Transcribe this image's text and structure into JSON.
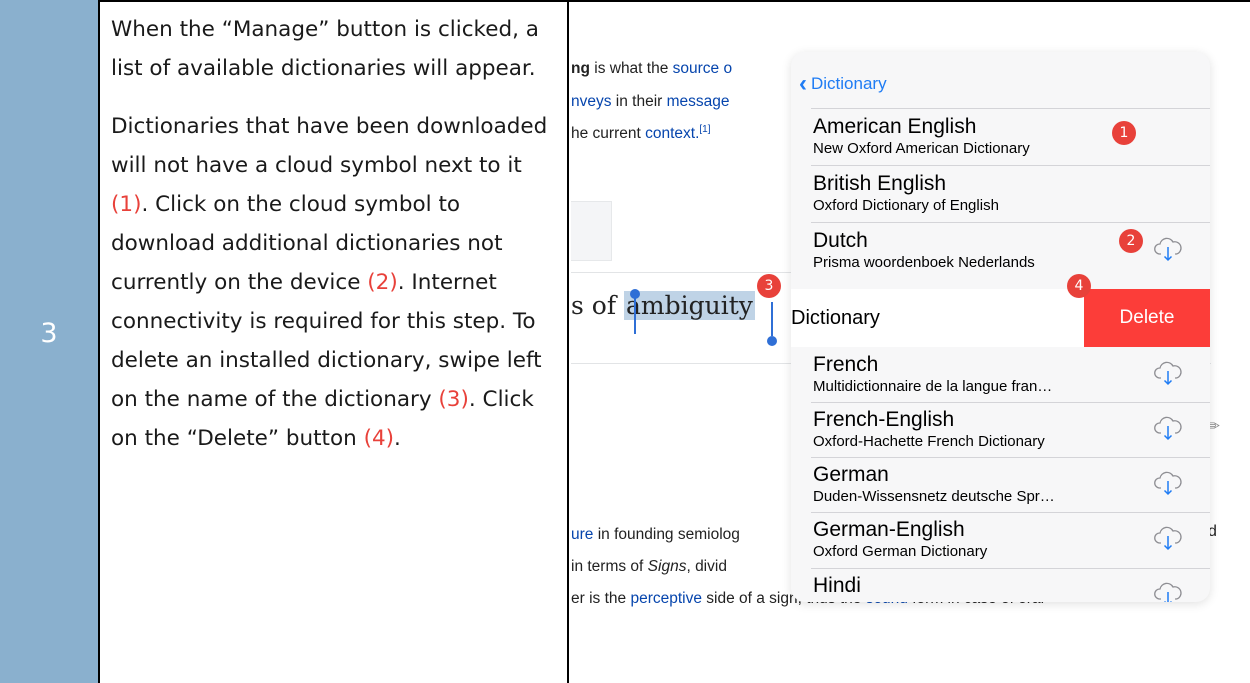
{
  "step": {
    "number": "3"
  },
  "instructions": {
    "para1": "When the “Manage” button is clicked, a list of available dictionaries will appear.",
    "para2": {
      "t1": "Dictionaries that have been downloaded will not have a cloud symbol next to it ",
      "r1": "(1)",
      "t2": ".  Click on the cloud symbol to download additional dictionaries not currently on the device ",
      "r2": "(2)",
      "t3": ". Internet connectivity is required for this step. To delete an installed dictionary, swipe left on the name of the dictionary ",
      "r3": "(3)",
      "t4": ". Click on the “Delete” button ",
      "r4": "(4)",
      "t5": "."
    }
  },
  "background_article": {
    "line1": {
      "bold": "ng",
      "plain": " is what the ",
      "link": "source o"
    },
    "line2": {
      "link": "nveys",
      "plain": " in their ",
      "link2": "message"
    },
    "line3": {
      "plain": "he current ",
      "link": "context.",
      "sup": "[1]"
    },
    "selection_text": {
      "before": "s of ",
      "selected": "ambiguity"
    },
    "line4": {
      "link": "ure",
      "plain": " in founding semiolog"
    },
    "line5": {
      "plain": "in terms of ",
      "italic": "Signs",
      "plain2": ", divid"
    },
    "line6": {
      "plain": "er is the ",
      "link": "perceptive",
      "plain2": " side of a sign, thus the ",
      "link2": "sound",
      "plain3": " form in case of oral"
    },
    "trailing_char": "d"
  },
  "popover": {
    "back_label": "Dictionary",
    "swipe_row": {
      "label": "Dictionary",
      "delete_label": "Delete"
    },
    "dictionaries": [
      {
        "name": "American English",
        "subtitle": "New Oxford American Dictionary",
        "downloaded": true
      },
      {
        "name": "British English",
        "subtitle": "Oxford Dictionary of English",
        "downloaded": true
      },
      {
        "name": "Dutch",
        "subtitle": "Prisma woordenboek Nederlands",
        "downloaded": false
      },
      {
        "name": "French",
        "subtitle": "Multidictionnaire de la langue fran…",
        "downloaded": false
      },
      {
        "name": "French-English",
        "subtitle": "Oxford-Hachette French Dictionary",
        "downloaded": false
      },
      {
        "name": "German",
        "subtitle": "Duden-Wissensnetz deutsche Spr…",
        "downloaded": false
      },
      {
        "name": "German-English",
        "subtitle": "Oxford German Dictionary",
        "downloaded": false
      },
      {
        "name": "Hindi",
        "subtitle": "",
        "downloaded": false
      }
    ]
  },
  "badges": [
    "1",
    "2",
    "3",
    "4"
  ],
  "colors": {
    "step_cell": "#8ab0ce",
    "reference": "#e8413a",
    "ios_blue": "#1f7cf4",
    "delete": "#fc3d39"
  }
}
